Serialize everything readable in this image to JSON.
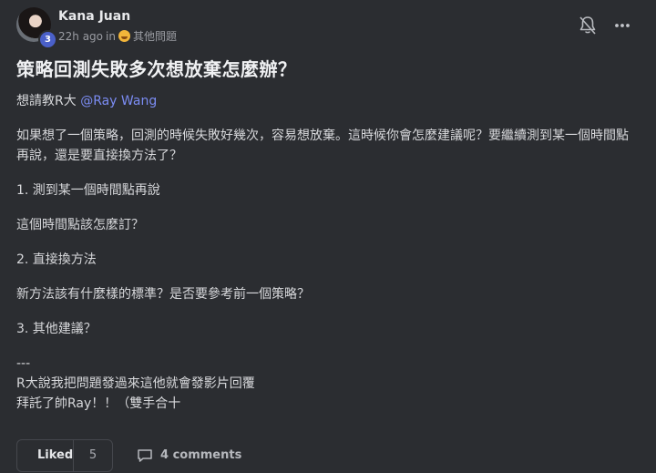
{
  "post": {
    "author": "Kana Juan",
    "level": "3",
    "time": "22h ago",
    "in_word": "in",
    "category": "其他問題",
    "title": "策略回測失敗多次想放棄怎麼辦？",
    "greeting": "想請教R大",
    "mention": "@Ray Wang",
    "paragraph1": "如果想了一個策略，回測的時候失敗好幾次，容易想放棄。這時候你會怎麼建議呢？要繼續測到某一個時間點再說，還是要直接換方法了？",
    "item1": "1. 測到某一個時間點再說",
    "item1_note": "這個時間點該怎麼訂？",
    "item2": "2. 直接換方法",
    "item2_note": "新方法該有什麼樣的標準？是否要參考前一個策略？",
    "item3": "3. 其他建議？",
    "separator": "---",
    "closing1": "R大說我把問題發過來這他就會發影片回覆",
    "closing2": "拜託了帥Ray！！（雙手合十"
  },
  "footer": {
    "like_label": "Liked",
    "like_count": "5",
    "comments_label": "4 comments"
  },
  "icons": {
    "bell": "bell-off-icon",
    "more": "more-horizontal-icon",
    "thumbs_up": "thumbs-up-icon",
    "comment": "comment-icon"
  }
}
